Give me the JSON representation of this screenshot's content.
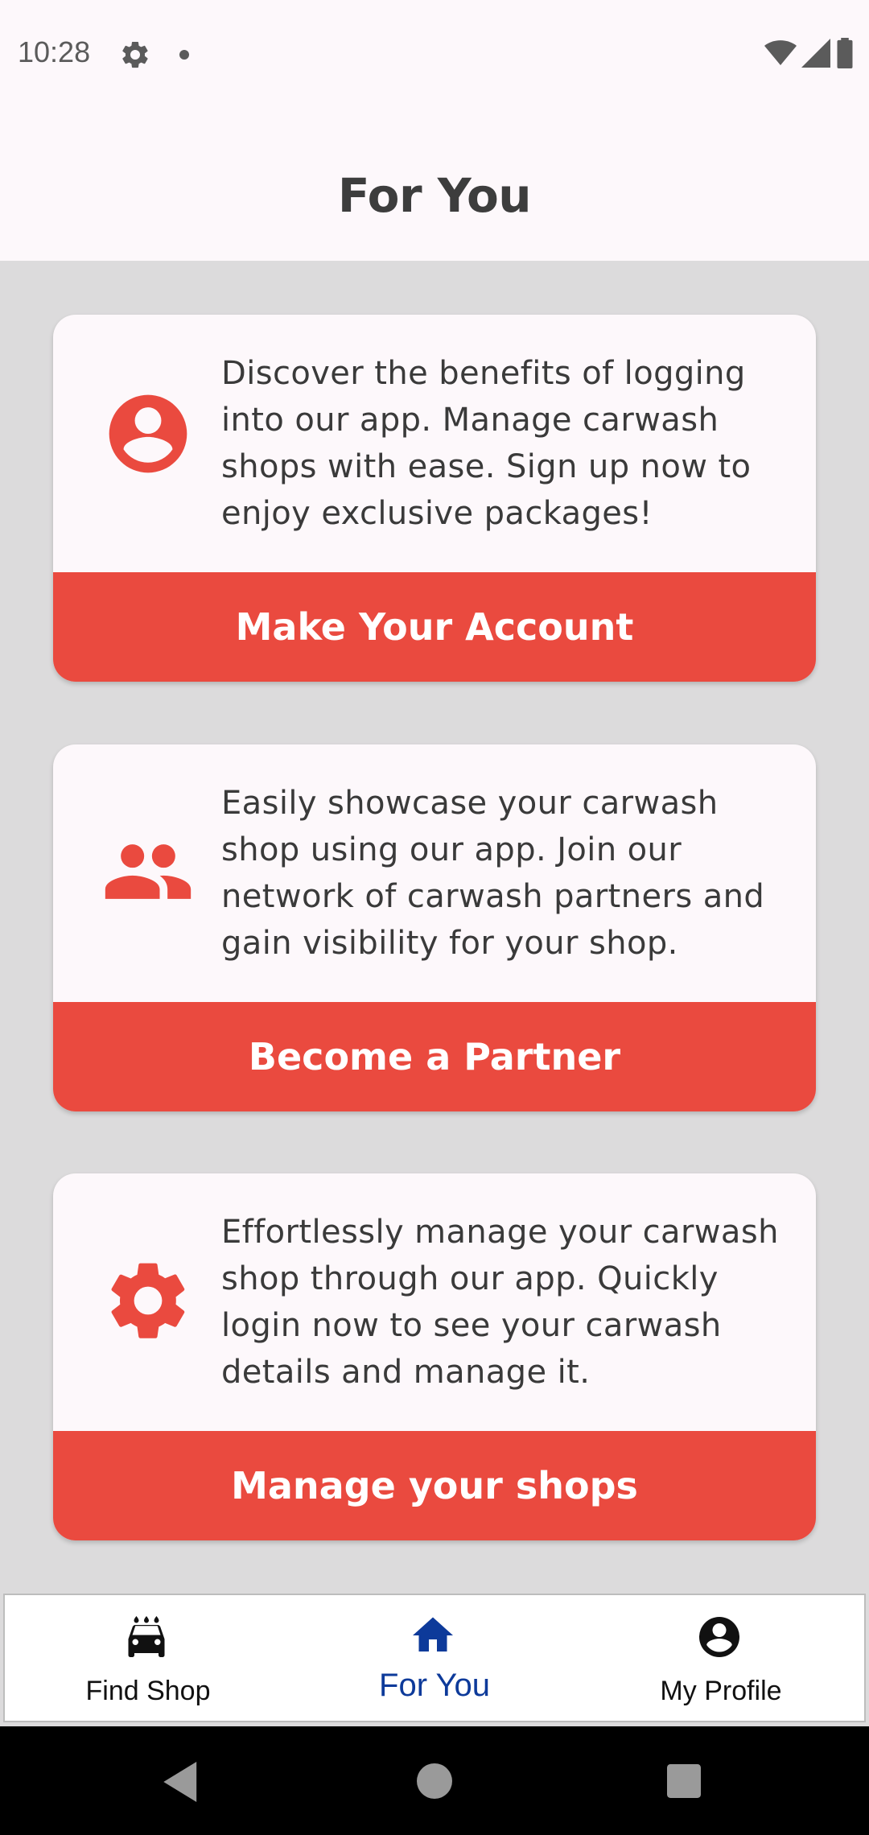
{
  "status_bar": {
    "time": "10:28"
  },
  "header": {
    "title": "For You"
  },
  "cards": [
    {
      "icon": "account-circle-icon",
      "text": "Discover the benefits of logging into our app. Manage carwash shops with ease. Sign up now to enjoy exclusive packages!",
      "button_label": "Make Your Account"
    },
    {
      "icon": "people-icon",
      "text": "Easily showcase your carwash shop using our app. Join our network of carwash partners and gain visibility for your shop.",
      "button_label": "Become a Partner"
    },
    {
      "icon": "gear-icon",
      "text": "Effortlessly manage your carwash shop through our app. Quickly login now to see your carwash details and manage it.",
      "button_label": "Manage your shops"
    }
  ],
  "bottom_nav": {
    "items": [
      {
        "label": "Find Shop",
        "icon": "car-wash-icon",
        "active": false
      },
      {
        "label": "For You",
        "icon": "home-icon",
        "active": true
      },
      {
        "label": "My Profile",
        "icon": "account-circle-icon",
        "active": false
      }
    ]
  },
  "colors": {
    "accent": "#ea4a3f",
    "active_nav": "#0d3a9a",
    "background": "#dcdbdc",
    "surface": "#fdf8fb"
  }
}
